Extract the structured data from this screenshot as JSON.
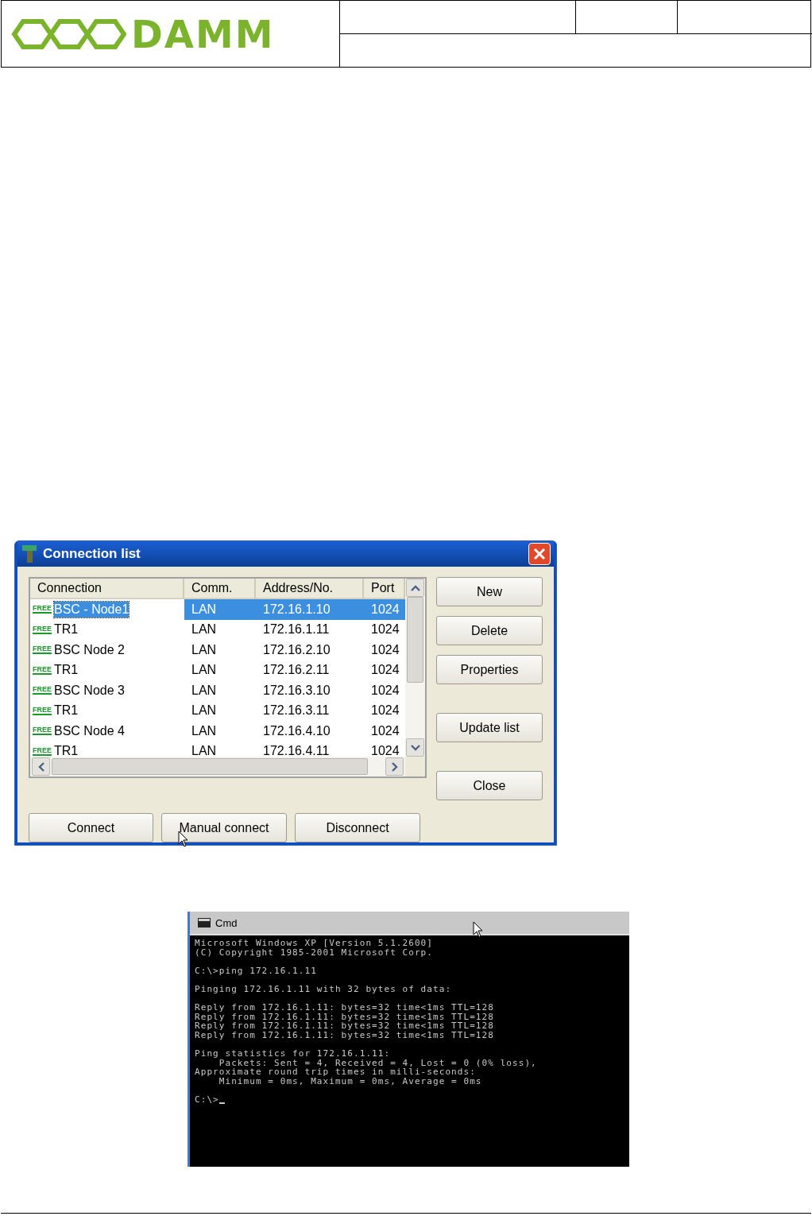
{
  "header": {
    "logo": "DAMM"
  },
  "connection_list": {
    "title": "Connection list",
    "columns": [
      "Connection",
      "Comm.",
      "Address/No.",
      "Port"
    ],
    "rows": [
      {
        "tag": "FREE",
        "name": "BSC - Node1",
        "comm": "LAN",
        "address": "172.16.1.10",
        "port": "1024",
        "selected": true
      },
      {
        "tag": "FREE",
        "name": "TR1",
        "comm": "LAN",
        "address": "172.16.1.11",
        "port": "1024",
        "selected": false
      },
      {
        "tag": "FREE",
        "name": "BSC Node 2",
        "comm": "LAN",
        "address": "172.16.2.10",
        "port": "1024",
        "selected": false
      },
      {
        "tag": "FREE",
        "name": "TR1",
        "comm": "LAN",
        "address": "172.16.2.11",
        "port": "1024",
        "selected": false
      },
      {
        "tag": "FREE",
        "name": "BSC Node 3",
        "comm": "LAN",
        "address": "172.16.3.10",
        "port": "1024",
        "selected": false
      },
      {
        "tag": "FREE",
        "name": "TR1",
        "comm": "LAN",
        "address": "172.16.3.11",
        "port": "1024",
        "selected": false
      },
      {
        "tag": "FREE",
        "name": "BSC Node 4",
        "comm": "LAN",
        "address": "172.16.4.10",
        "port": "1024",
        "selected": false
      },
      {
        "tag": "FREE",
        "name": "TR1",
        "comm": "LAN",
        "address": "172.16.4.11",
        "port": "1024",
        "selected": false
      }
    ],
    "side_buttons": [
      "New",
      "Delete",
      "Properties",
      "Update list",
      "Close"
    ],
    "bottom_buttons": [
      "Connect",
      "Manual connect",
      "Disconnect"
    ]
  },
  "cmd": {
    "title": "Cmd",
    "blocks": [
      [
        "Microsoft Windows XP [Version 5.1.2600]",
        "(C) Copyright 1985-2001 Microsoft Corp."
      ],
      [
        "C:\\>ping 172.16.1.11"
      ],
      [
        "Pinging 172.16.1.11 with 32 bytes of data:"
      ],
      [
        "Reply from 172.16.1.11: bytes=32 time<1ms TTL=128",
        "Reply from 172.16.1.11: bytes=32 time<1ms TTL=128",
        "Reply from 172.16.1.11: bytes=32 time<1ms TTL=128",
        "Reply from 172.16.1.11: bytes=32 time<1ms TTL=128"
      ],
      [
        "Ping statistics for 172.16.1.11:",
        "    Packets: Sent = 4, Received = 4, Lost = 0 (0% loss),",
        "Approximate round trip times in milli-seconds:",
        "    Minimum = 0ms, Maximum = 0ms, Average = 0ms"
      ]
    ],
    "prompt": "C:\\>"
  }
}
